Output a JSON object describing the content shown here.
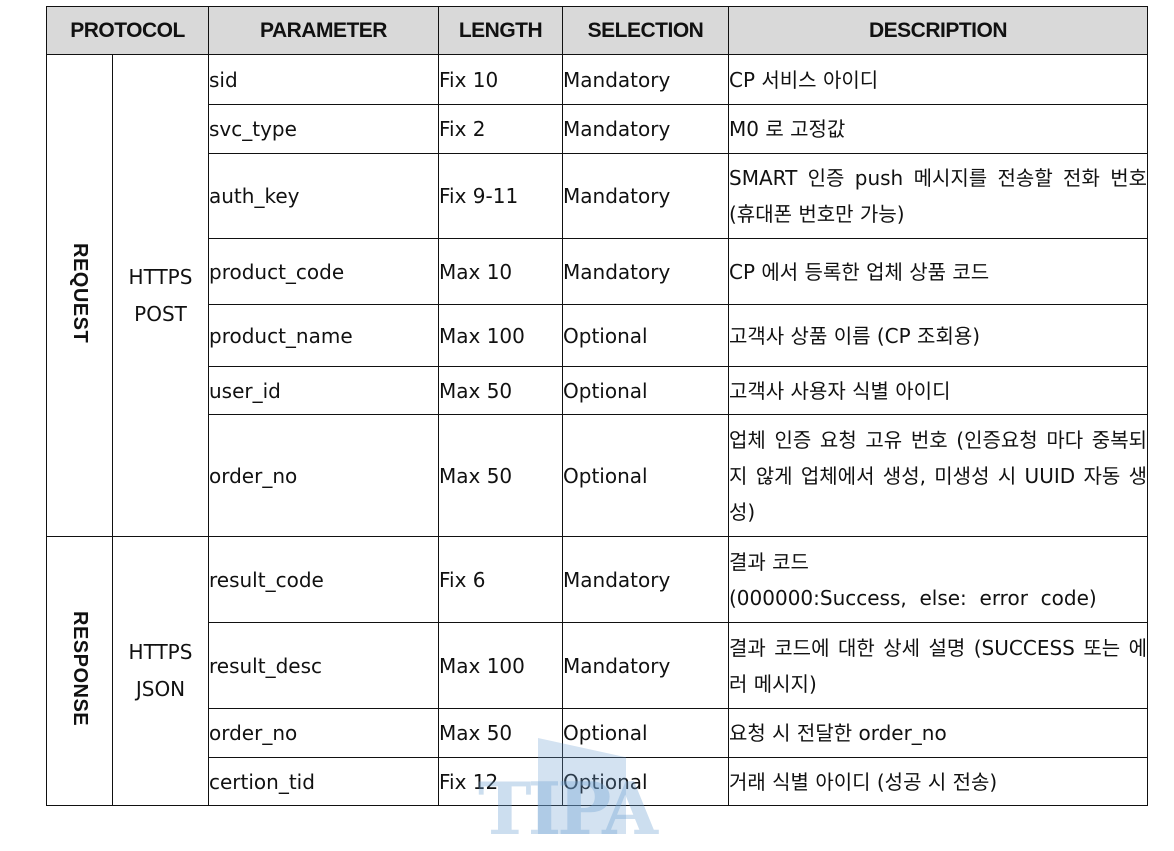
{
  "headers": {
    "protocol": "PROTOCOL",
    "parameter": "PARAMETER",
    "length": "LENGTH",
    "selection": "SELECTION",
    "description": "DESCRIPTION"
  },
  "request": {
    "group": "REQUEST",
    "method_line1": "HTTPS",
    "method_line2": "POST",
    "rows": [
      {
        "parameter": "sid",
        "length": "Fix  10",
        "selection": "Mandatory",
        "description": "CP 서비스 아이디"
      },
      {
        "parameter": "svc_type",
        "length": "Fix  2",
        "selection": "Mandatory",
        "description": "M0 로 고정값"
      },
      {
        "parameter": "auth_key",
        "length": "Fix  9-11",
        "selection": "Mandatory",
        "description": "SMART 인증 push 메시지를 전송할 전화 번호 (휴대폰 번호만 가능)"
      },
      {
        "parameter": "product_code",
        "length": "Max  10",
        "selection": "Mandatory",
        "description": "CP 에서 등록한 업체 상품 코드"
      },
      {
        "parameter": "product_name",
        "length": "Max  100",
        "selection": "Optional",
        "description": "고객사 상품 이름 (CP 조회용)"
      },
      {
        "parameter": "user_id",
        "length": "Max  50",
        "selection": "Optional",
        "description": "고객사 사용자 식별 아이디"
      },
      {
        "parameter": "order_no",
        "length": "Max  50",
        "selection": "Optional",
        "description": "업체 인증 요청 고유 번호 (인증요청 마다 중복되지 않게 업체에서 생성, 미생성 시 UUID 자동 생성)"
      }
    ]
  },
  "response": {
    "group": "RESPONSE",
    "method_line1": "HTTPS",
    "method_line2": "JSON",
    "rows": [
      {
        "parameter": "result_code",
        "length": "Fix  6",
        "selection": "Mandatory",
        "description_line1": "결과 코드",
        "description_line2": "(000000:Success,  else:  error  code)"
      },
      {
        "parameter": "result_desc",
        "length": "Max  100",
        "selection": "Mandatory",
        "description": "결과 코드에 대한 상세 설명 (SUCCESS 또는 에러 메시지)"
      },
      {
        "parameter": "order_no",
        "length": "Max  50",
        "selection": "Optional",
        "description": "요청 시 전달한 order_no"
      },
      {
        "parameter": "certion_tid",
        "length": "Fix  12",
        "selection": "Optional",
        "description": "거래 식별 아이디 (성공 시 전송)"
      }
    ]
  },
  "watermark": {
    "text": "TIPA"
  }
}
